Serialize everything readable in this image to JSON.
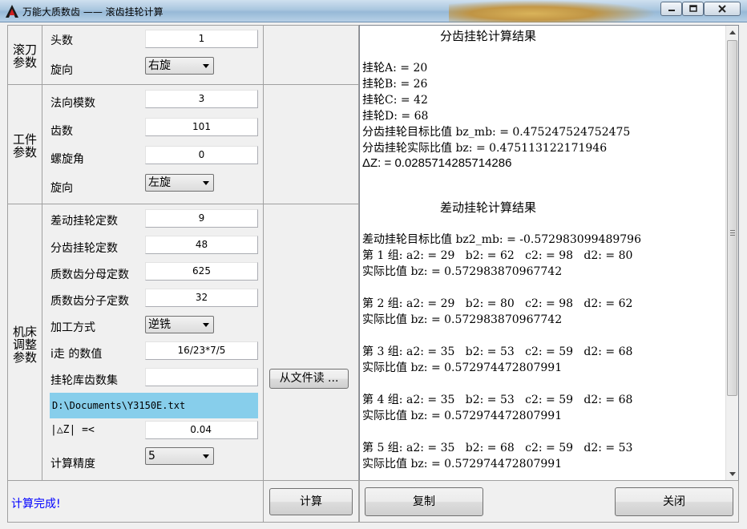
{
  "window": {
    "title": "万能大质数齿 —— 滚齿挂轮计算",
    "icon": "app-logo-icon",
    "controls": [
      "minimize-icon",
      "maximize-icon",
      "close-icon"
    ]
  },
  "groups": {
    "hob": {
      "label": "滚刀\n参数"
    },
    "work": {
      "label": "工件\n参数"
    },
    "machine": {
      "label": "机床\n调整\n参数"
    }
  },
  "fields": {
    "starts": {
      "label": "头数",
      "value": "1"
    },
    "hob_direction": {
      "label": "旋向",
      "value": "右旋"
    },
    "normal_module": {
      "label": "法向模数",
      "value": "3"
    },
    "teeth": {
      "label": "齿数",
      "value": "101"
    },
    "helix_angle": {
      "label": "螺旋角",
      "value": "0"
    },
    "work_direction": {
      "label": "旋向",
      "value": "左旋"
    },
    "diff_constant": {
      "label": "差动挂轮定数",
      "value": "9"
    },
    "index_constant": {
      "label": "分齿挂轮定数",
      "value": "48"
    },
    "prime_denominator": {
      "label": "质数齿分母定数",
      "value": "625"
    },
    "prime_numerator": {
      "label": "质数齿分子定数",
      "value": "32"
    },
    "process_mode": {
      "label": "加工方式",
      "value": "逆铣"
    },
    "i_feed": {
      "label": "i走 的数值",
      "value": "16/23*7/5"
    },
    "gear_set": {
      "label": "挂轮库齿数集",
      "value": ""
    },
    "file_path": {
      "value": "D:\\Documents\\Y3150E.txt"
    },
    "delta_z": {
      "label": "|△Z| =<",
      "value": "0.04"
    },
    "precision": {
      "label": "计算精度",
      "value": "5"
    }
  },
  "buttons": {
    "read_file": "从文件读 ...",
    "calculate": "计算",
    "copy": "复制",
    "close": "关闭"
  },
  "status": "计算完成!",
  "results": {
    "index_title": "分齿挂轮计算结果",
    "index_lines": [
      "挂轮A: = 20",
      "挂轮B: = 26",
      "挂轮C: = 42",
      "挂轮D: = 68",
      "分齿挂轮目标比值 bz_mb: = 0.475247524752475",
      "分齿挂轮实际比值 bz: = 0.475113122171946"
    ],
    "delta_line": "ΔZ: = 0.0285714285714286",
    "diff_title": "差动挂轮计算结果",
    "diff_target": "差动挂轮目标比值 bz2_mb: = -0.572983099489796",
    "groups": [
      {
        "line": "第 1 组: a2: = 29   b2: = 62   c2: = 98   d2: = 80",
        "ratio": "实际比值 bz: = 0.572983870967742"
      },
      {
        "line": "第 2 组: a2: = 29   b2: = 80   c2: = 98   d2: = 62",
        "ratio": "实际比值 bz: = 0.572983870967742"
      },
      {
        "line": "第 3 组: a2: = 35   b2: = 53   c2: = 59   d2: = 68",
        "ratio": "实际比值 bz: = 0.572974472807991"
      },
      {
        "line": "第 4 组: a2: = 35   b2: = 53   c2: = 59   d2: = 68",
        "ratio": "实际比值 bz: = 0.572974472807991"
      },
      {
        "line": "第 5 组: a2: = 35   b2: = 68   c2: = 59   d2: = 53",
        "ratio": "实际比值 bz: = 0.572974472807991"
      }
    ]
  }
}
